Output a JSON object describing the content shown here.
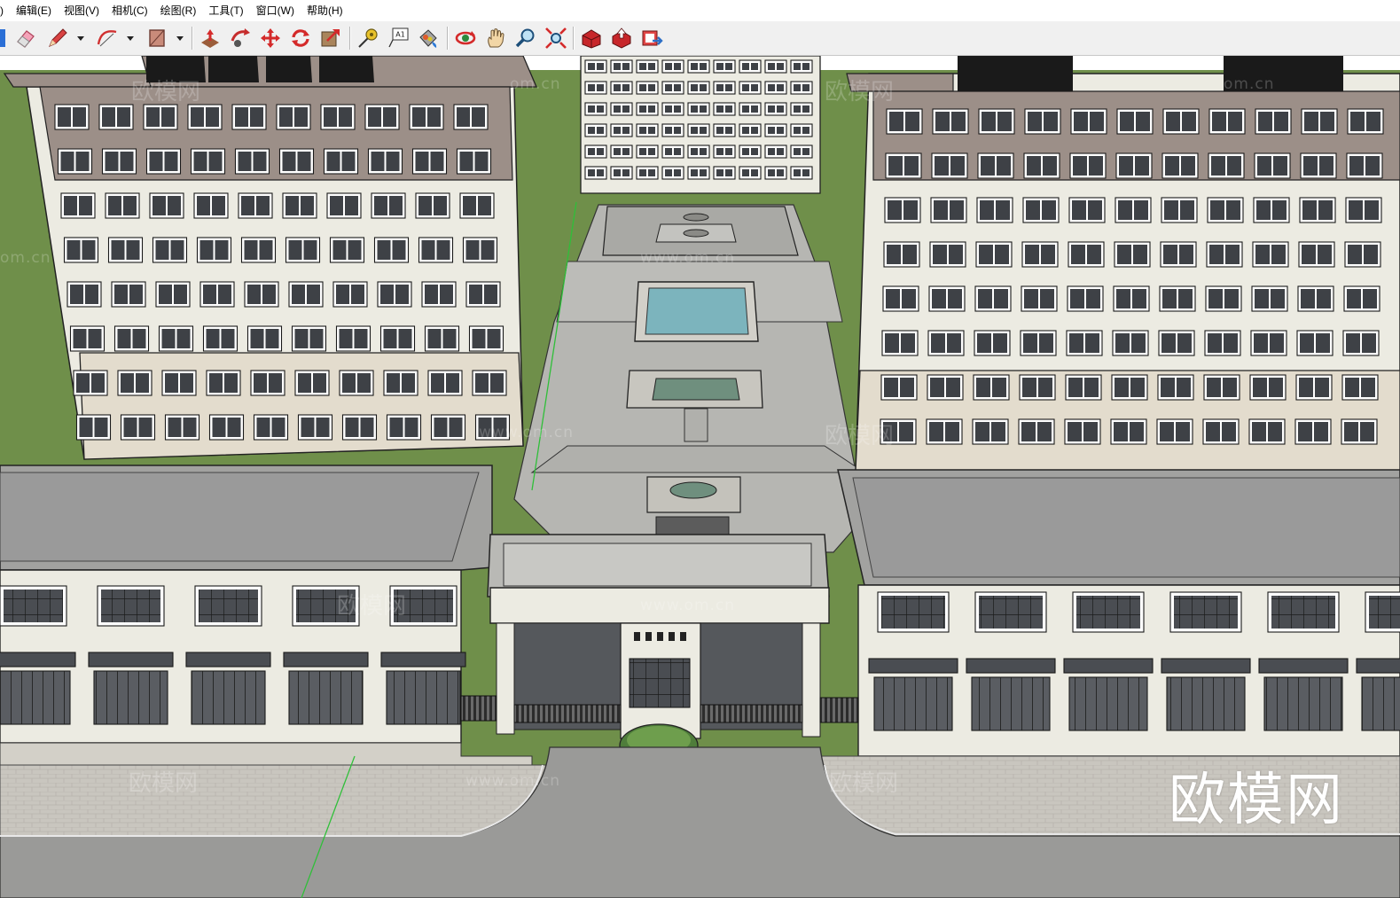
{
  "menu": [
    {
      "id": "file",
      "label": ")"
    },
    {
      "id": "edit",
      "label": "编辑(E)"
    },
    {
      "id": "view",
      "label": "视图(V)"
    },
    {
      "id": "camera",
      "label": "相机(C)"
    },
    {
      "id": "draw",
      "label": "绘图(R)"
    },
    {
      "id": "tools",
      "label": "工具(T)"
    },
    {
      "id": "window",
      "label": "窗口(W)"
    },
    {
      "id": "help",
      "label": "帮助(H)"
    }
  ],
  "toolbar": {
    "text_tool_badge": "A1",
    "buttons": [
      {
        "icon": "select-arrow-icon"
      },
      {
        "icon": "eraser-icon"
      },
      {
        "icon": "pencil-icon"
      },
      {
        "icon": "arc-icon"
      },
      {
        "icon": "rectangle-icon"
      },
      {
        "icon": "push-pull-icon"
      },
      {
        "icon": "follow-me-icon"
      },
      {
        "icon": "move-icon"
      },
      {
        "icon": "rotate-icon"
      },
      {
        "icon": "scale-icon"
      },
      {
        "icon": "tape-measure-icon"
      },
      {
        "icon": "text-icon"
      },
      {
        "icon": "paint-bucket-icon"
      },
      {
        "icon": "orbit-icon"
      },
      {
        "icon": "pan-icon"
      },
      {
        "icon": "zoom-icon"
      },
      {
        "icon": "zoom-extents-icon"
      },
      {
        "icon": "warehouse-icon"
      },
      {
        "icon": "share-model-icon"
      },
      {
        "icon": "extension-warehouse-icon"
      }
    ]
  },
  "watermarks": {
    "site": "www.om.cn",
    "site_short": "om.cn",
    "brand": "欧模网"
  },
  "colors": {
    "grass": "#6f8f4a",
    "facade": "#ecebe2",
    "upper_facade": "#9c8f88",
    "roof": "#9a9a9a",
    "pool": "#7fb7bf",
    "glass": "#3e4146"
  }
}
